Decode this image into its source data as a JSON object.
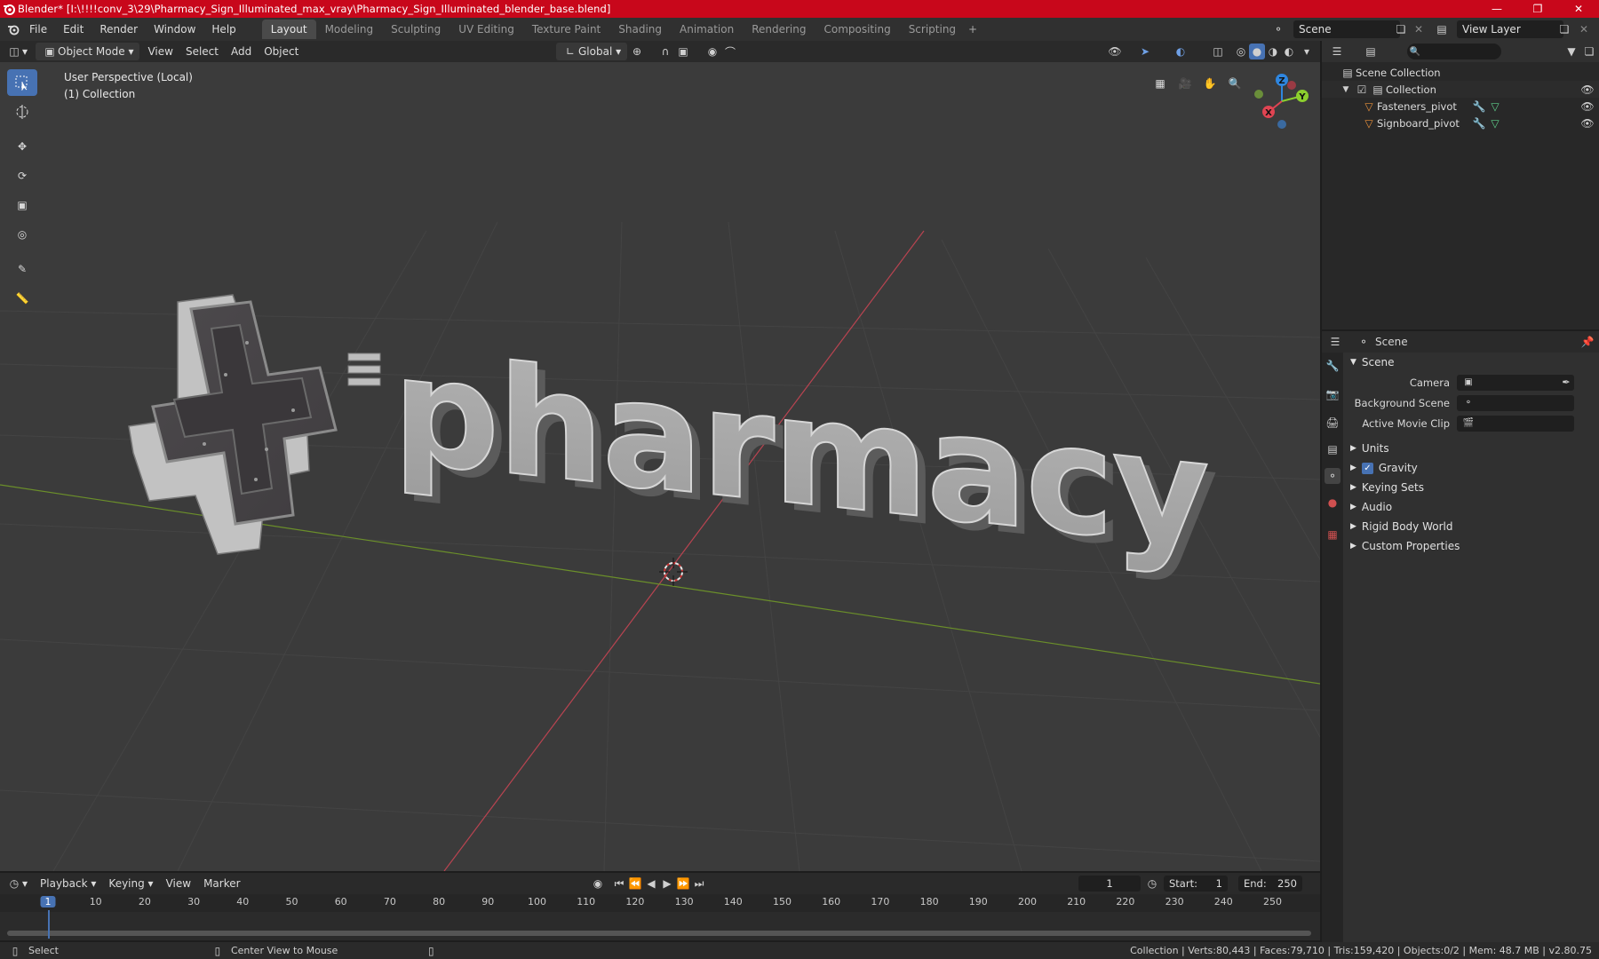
{
  "titlebar": {
    "title": "Blender* [I:\\!!!!conv_3\\29\\Pharmacy_Sign_Illuminated_max_vray\\Pharmacy_Sign_Illuminated_blender_base.blend]"
  },
  "menu": {
    "file": "File",
    "edit": "Edit",
    "render": "Render",
    "window": "Window",
    "help": "Help"
  },
  "workspaces": [
    "Layout",
    "Modeling",
    "Sculpting",
    "UV Editing",
    "Texture Paint",
    "Shading",
    "Animation",
    "Rendering",
    "Compositing",
    "Scripting"
  ],
  "scene_selector": "Scene",
  "view_layer": "View Layer",
  "viewport_header": {
    "mode": "Object Mode",
    "view": "View",
    "select": "Select",
    "add": "Add",
    "object": "Object",
    "orientation": "Global"
  },
  "viewport": {
    "perspective": "User Perspective (Local)",
    "collection": "(1) Collection",
    "sign_text": "pharmacy",
    "gizmo": {
      "z": "Z",
      "y": "Y",
      "x": "X"
    }
  },
  "outliner": {
    "scene_collection": "Scene Collection",
    "collection": "Collection",
    "items": [
      "Fasteners_pivot",
      "Signboard_pivot"
    ]
  },
  "properties": {
    "header": "Scene",
    "panel": "Scene",
    "camera_label": "Camera",
    "background_scene_label": "Background Scene",
    "active_movie_clip_label": "Active Movie Clip",
    "sections": [
      "Units",
      "Gravity",
      "Keying Sets",
      "Audio",
      "Rigid Body World",
      "Custom Properties"
    ],
    "gravity_enabled": true
  },
  "timeline": {
    "playback": "Playback",
    "keying": "Keying",
    "view": "View",
    "marker": "Marker",
    "current_frame": "1",
    "start_label": "Start:",
    "start": "1",
    "end_label": "End:",
    "end": "250",
    "ticks": [
      "1",
      "10",
      "20",
      "30",
      "40",
      "50",
      "60",
      "70",
      "80",
      "90",
      "100",
      "110",
      "120",
      "130",
      "140",
      "150",
      "160",
      "170",
      "180",
      "190",
      "200",
      "210",
      "220",
      "230",
      "240",
      "250"
    ]
  },
  "statusbar": {
    "select": "Select",
    "center": "Center View to Mouse",
    "stats": "Collection | Verts:80,443 | Faces:79,710 | Tris:159,420 | Objects:0/2 | Mem: 48.7 MB | v2.80.75"
  },
  "colors": {
    "title_red": "#c8071b",
    "active_blue": "#4772b3",
    "x_axis": "#e04452",
    "y_axis": "#8ccf2e",
    "z_axis": "#2e86e0",
    "object_orange": "#e8903a"
  }
}
